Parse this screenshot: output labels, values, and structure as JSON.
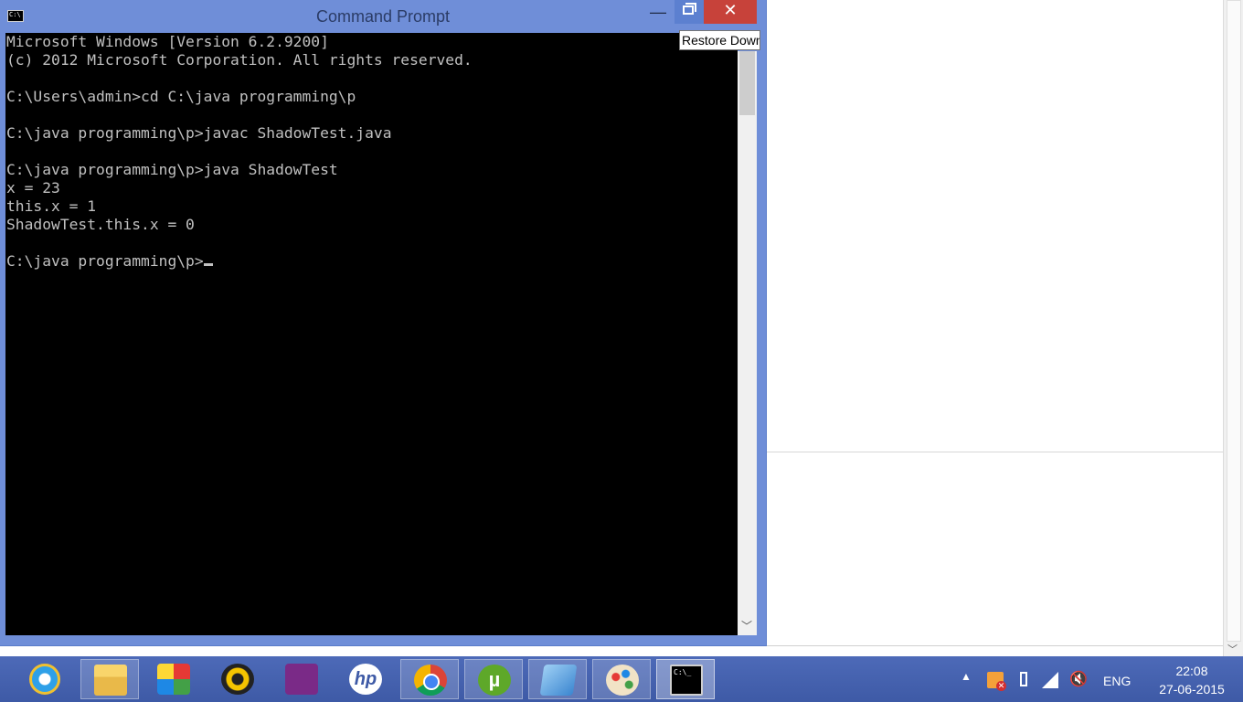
{
  "window": {
    "title": "Command Prompt",
    "minimize_glyph": "—",
    "close_glyph": "✕",
    "tooltip": "Restore Down"
  },
  "console": {
    "lines": [
      "Microsoft Windows [Version 6.2.9200]",
      "(c) 2012 Microsoft Corporation. All rights reserved.",
      "",
      "C:\\Users\\admin>cd C:\\java programming\\p",
      "",
      "C:\\java programming\\p>javac ShadowTest.java",
      "",
      "C:\\java programming\\p>java ShadowTest",
      "x = 23",
      "this.x = 1",
      "ShadowTest.this.x = 0",
      "",
      "C:\\java programming\\p>"
    ]
  },
  "taskbar": {
    "items": [
      {
        "name": "internet-explorer-icon",
        "state": "pinned"
      },
      {
        "name": "file-explorer-icon",
        "state": "open"
      },
      {
        "name": "puzzle-app-icon",
        "state": "pinned"
      },
      {
        "name": "webcam-app-icon",
        "state": "pinned"
      },
      {
        "name": "wireless-display-icon",
        "state": "pinned"
      },
      {
        "name": "hp-icon",
        "state": "pinned"
      },
      {
        "name": "chrome-icon",
        "state": "open"
      },
      {
        "name": "utorrent-icon",
        "state": "open"
      },
      {
        "name": "notepad-icon",
        "state": "open"
      },
      {
        "name": "paint-icon",
        "state": "open"
      },
      {
        "name": "command-prompt-icon",
        "state": "active"
      }
    ],
    "hp_text": "hp",
    "torrent_text": "µ",
    "cmd_icon_text": "C:\\_"
  },
  "tray": {
    "language": "ENG",
    "time": "22:08",
    "date": "27-06-2015"
  },
  "colors": {
    "titlebar": "#6f8ed8",
    "close_button": "#c7423a",
    "console_bg": "#000000",
    "console_text": "#c0c0c0",
    "taskbar": "#4d6ab8"
  }
}
